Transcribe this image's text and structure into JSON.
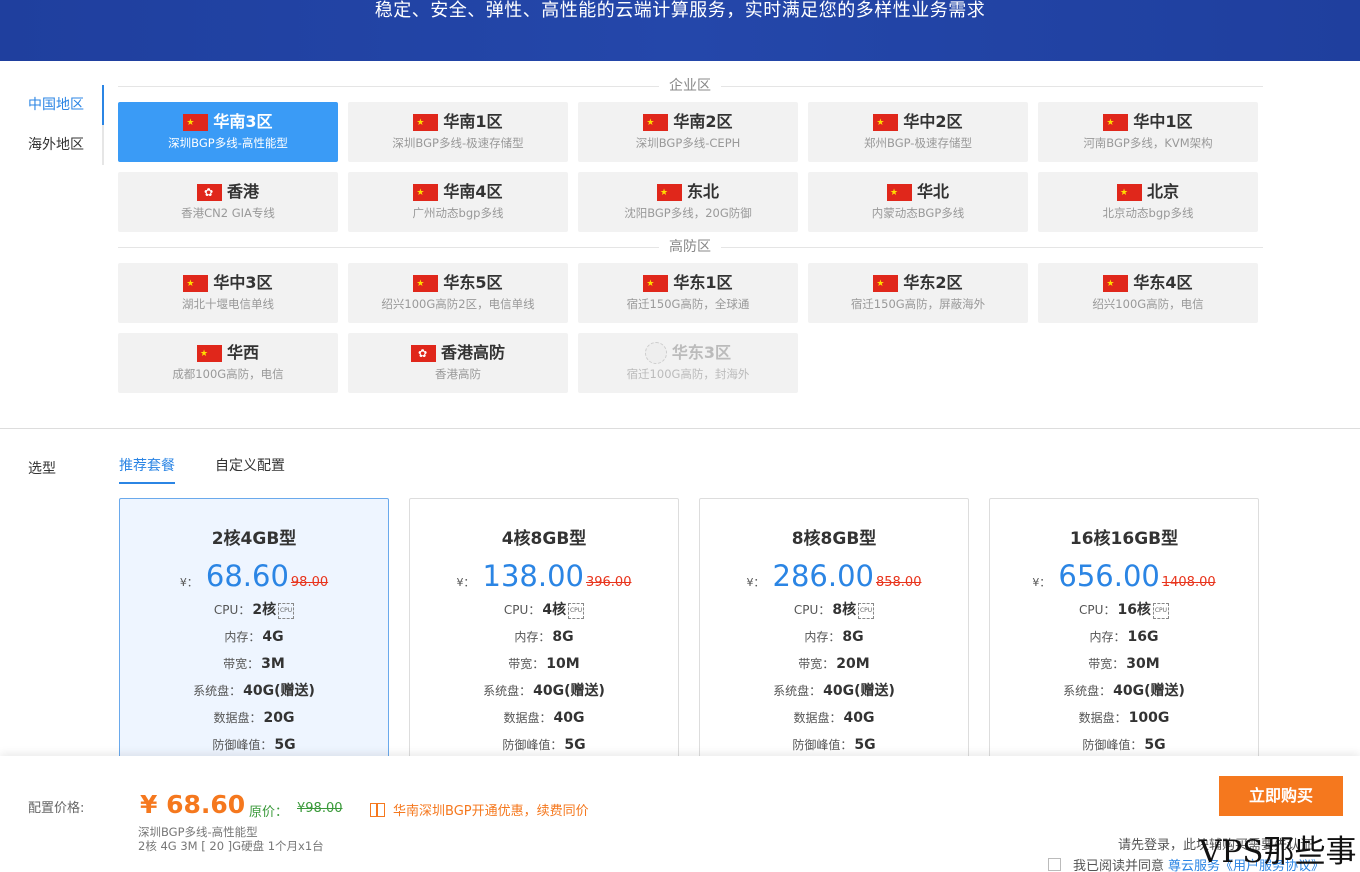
{
  "banner": {
    "title": "稳定、安全、弹性、高性能的云端计算服务，实时满足您的多样性业务需求"
  },
  "region_tabs": [
    {
      "label": "中国地区",
      "active": true
    },
    {
      "label": "海外地区",
      "active": false
    }
  ],
  "enterprise": {
    "title": "企业区",
    "zones": [
      {
        "name": "华南3区",
        "desc": "深圳BGP多线-高性能型",
        "flag": "cn",
        "active": true
      },
      {
        "name": "华南1区",
        "desc": "深圳BGP多线-极速存储型",
        "flag": "cn"
      },
      {
        "name": "华南2区",
        "desc": "深圳BGP多线-CEPH",
        "flag": "cn"
      },
      {
        "name": "华中2区",
        "desc": "郑州BGP-极速存储型",
        "flag": "cn"
      },
      {
        "name": "华中1区",
        "desc": "河南BGP多线，KVM架构",
        "flag": "cn"
      },
      {
        "name": "香港",
        "desc": "香港CN2 GIA专线",
        "flag": "hk"
      },
      {
        "name": "华南4区",
        "desc": "广州动态bgp多线",
        "flag": "cn"
      },
      {
        "name": "东北",
        "desc": "沈阳BGP多线，20G防御",
        "flag": "cn"
      },
      {
        "name": "华北",
        "desc": "内蒙动态BGP多线",
        "flag": "cn"
      },
      {
        "name": "北京",
        "desc": "北京动态bgp多线",
        "flag": "cn"
      }
    ]
  },
  "ddos": {
    "title": "高防区",
    "zones": [
      {
        "name": "华中3区",
        "desc": "湖北十堰电信单线",
        "flag": "cn"
      },
      {
        "name": "华东5区",
        "desc": "绍兴100G高防2区，电信单线",
        "flag": "cn"
      },
      {
        "name": "华东1区",
        "desc": "宿迁150G高防，全球通",
        "flag": "cn"
      },
      {
        "name": "华东2区",
        "desc": "宿迁150G高防，屏蔽海外",
        "flag": "cn"
      },
      {
        "name": "华东4区",
        "desc": "绍兴100G高防，电信",
        "flag": "cn"
      },
      {
        "name": "华西",
        "desc": "成都100G高防，电信",
        "flag": "cn"
      },
      {
        "name": "香港高防",
        "desc": "香港高防",
        "flag": "hk"
      },
      {
        "name": "华东3区",
        "desc": "宿迁100G高防，封海外",
        "flag": "na",
        "disabled": true
      }
    ]
  },
  "selection": {
    "label": "选型",
    "tabs": [
      {
        "label": "推荐套餐",
        "active": true
      },
      {
        "label": "自定义配置"
      }
    ]
  },
  "spec_labels": {
    "cpu": "CPU：",
    "mem": "内存：",
    "bw": "带宽：",
    "sys": "系统盘：",
    "data": "数据盘：",
    "ddos": "防御峰值：",
    "currency": "¥："
  },
  "plans": [
    {
      "title": "2核4GB型",
      "price": "68.60",
      "orig": "98.00",
      "cpu": "2核",
      "mem": "4G",
      "bw": "3M",
      "sys": "40G(赠送)",
      "data": "20G",
      "ddos": "5G",
      "active": true
    },
    {
      "title": "4核8GB型",
      "price": "138.00",
      "orig": "396.00",
      "cpu": "4核",
      "mem": "8G",
      "bw": "10M",
      "sys": "40G(赠送)",
      "data": "40G",
      "ddos": "5G"
    },
    {
      "title": "8核8GB型",
      "price": "286.00",
      "orig": "858.00",
      "cpu": "8核",
      "mem": "8G",
      "bw": "20M",
      "sys": "40G(赠送)",
      "data": "40G",
      "ddos": "5G"
    },
    {
      "title": "16核16GB型",
      "price": "656.00",
      "orig": "1408.00",
      "cpu": "16核",
      "mem": "16G",
      "bw": "30M",
      "sys": "40G(赠送)",
      "data": "100G",
      "ddos": "5G"
    }
  ],
  "footer": {
    "label": "配置价格:",
    "price": "¥ 68.60",
    "orig_label": "原价：",
    "orig": "¥98.00",
    "promo": "华南深圳BGP开通优惠，续费同价",
    "desc1": "深圳BGP多线-高性能型",
    "desc2": "2核 4G 3M [ 20 ]G硬盘 1个月x1台",
    "buy": "立即购买",
    "login": "请先登录，此块辅购买需要先认证",
    "agree": "我已阅读并同意",
    "agree_link": "尊云服务《用户服务协议》"
  },
  "watermark": "VPS那些事"
}
